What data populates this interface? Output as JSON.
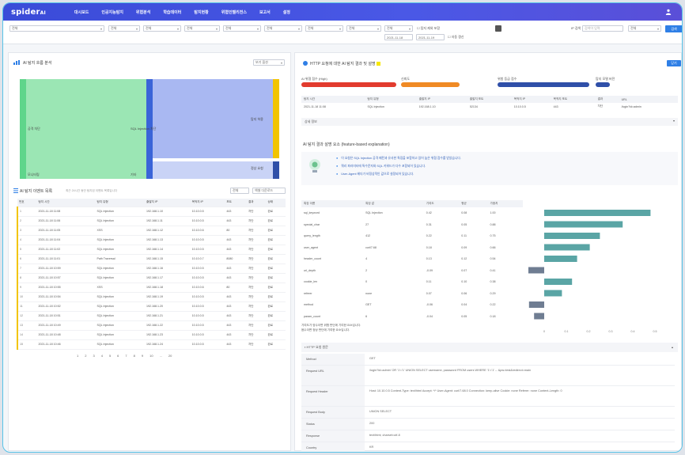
{
  "app": {
    "logo": "spider",
    "logo_suffix": "AI"
  },
  "nav": [
    "대시보드",
    "인공지능탐지",
    "위협분석",
    "학습데이터",
    "탐지현황",
    "위협인텔리전스",
    "보고서",
    "설정"
  ],
  "user_icon": "user-icon",
  "filters": {
    "type": "전체",
    "f2": "전체",
    "f3": "전체",
    "f4": "전체",
    "f5": "전체",
    "f6": "전체",
    "f7": "전체",
    "f8": "전체",
    "f9": "전체",
    "date1": "2021-11-18",
    "date2": "2021-11-19",
    "check1": "탐지 제외 포함",
    "check2": "자동 갱신",
    "search_placeholder": "검색어 입력",
    "search_label": "IP 검색",
    "search_button": "검색"
  },
  "left_panel": {
    "title": "AI 탐지 흐름 분석",
    "button": "보기 옵션",
    "sankey_labels": [
      "공격 차단",
      "SQL Injection 차단",
      "탐지 허용",
      "정상 요청",
      "모니터링",
      "기타"
    ],
    "list_title": "AI 탐지 이벤트 목록",
    "list_subtitle": "최근 24시간 동안 탐지된 이벤트 목록입니다",
    "list_btn1": "전체",
    "list_btn2": "엑셀 다운로드",
    "columns": [
      "번호",
      "탐지 시간",
      "탐지 유형",
      "출발지 IP",
      "목적지 IP",
      "포트",
      "결과",
      "상태"
    ],
    "rows": [
      [
        "1",
        "2021-11-18 11:08",
        "SQL Injection",
        "192.168.1.10",
        "10.10.0.5",
        "443",
        "차단",
        "완료"
      ],
      [
        "2",
        "2021-11-18 11:06",
        "SQL Injection",
        "192.168.1.11",
        "10.10.0.5",
        "443",
        "차단",
        "완료"
      ],
      [
        "3",
        "2021-11-18 11:05",
        "XSS",
        "192.168.1.12",
        "10.10.0.6",
        "80",
        "차단",
        "완료"
      ],
      [
        "4",
        "2021-11-18 11:04",
        "SQL Injection",
        "192.168.1.13",
        "10.10.0.5",
        "443",
        "차단",
        "완료"
      ],
      [
        "5",
        "2021-11-18 11:02",
        "SQL Injection",
        "192.168.1.14",
        "10.10.0.5",
        "443",
        "차단",
        "완료"
      ],
      [
        "6",
        "2021-11-18 11:01",
        "Path Traversal",
        "192.168.1.15",
        "10.10.0.7",
        "8080",
        "차단",
        "완료"
      ],
      [
        "7",
        "2021-11-18 10:59",
        "SQL Injection",
        "192.168.1.16",
        "10.10.0.5",
        "443",
        "차단",
        "완료"
      ],
      [
        "8",
        "2021-11-18 10:57",
        "SQL Injection",
        "192.168.1.17",
        "10.10.0.5",
        "443",
        "차단",
        "완료"
      ],
      [
        "9",
        "2021-11-18 10:55",
        "XSS",
        "192.168.1.18",
        "10.10.0.6",
        "80",
        "차단",
        "완료"
      ],
      [
        "10",
        "2021-11-18 10:54",
        "SQL Injection",
        "192.168.1.19",
        "10.10.0.5",
        "443",
        "차단",
        "완료"
      ],
      [
        "11",
        "2021-11-18 10:52",
        "SQL Injection",
        "192.168.1.20",
        "10.10.0.5",
        "443",
        "차단",
        "완료"
      ],
      [
        "12",
        "2021-11-18 10:51",
        "SQL Injection",
        "192.168.1.21",
        "10.10.0.5",
        "443",
        "차단",
        "완료"
      ],
      [
        "13",
        "2021-11-18 10:49",
        "SQL Injection",
        "192.168.1.22",
        "10.10.0.5",
        "443",
        "차단",
        "완료"
      ],
      [
        "14",
        "2021-11-18 10:48",
        "SQL Injection",
        "192.168.1.23",
        "10.10.0.5",
        "443",
        "차단",
        "완료"
      ],
      [
        "15",
        "2021-11-18 10:46",
        "SQL Injection",
        "192.168.1.24",
        "10.10.0.5",
        "443",
        "차단",
        "완료"
      ]
    ],
    "pages": [
      "1",
      "2",
      "3",
      "4",
      "5",
      "6",
      "7",
      "8",
      "9",
      "10",
      "...",
      "20"
    ]
  },
  "right_panel": {
    "title": "HTTP 요청에 대한 AI 탐지 결과 및 설명",
    "top_button": "닫기",
    "bar_labels": [
      "AI 위협 점수 (High)",
      "신뢰도",
      "위험 등급 점수",
      "탐지 모델 버전"
    ],
    "detail_columns": [
      "탐지 시간",
      "탐지 유형",
      "출발지 IP",
      "출발지 포트",
      "목적지 IP",
      "목적지 포트",
      "결과",
      "URL"
    ],
    "detail_row": [
      "2021-11-18 11:08",
      "SQL Injection",
      "192.168.1.10",
      "52134",
      "10.10.0.5",
      "443",
      "차단",
      "/login?id=admin"
    ],
    "more": "상세 정보",
    "explain_title": "AI 탐지 결과 설명 요소 (feature-based explanation)",
    "explain_items": [
      "이 요청은 SQL Injection 공격 패턴과 유사한 특징을 포함하고 있어 높은 위협 점수를 받았습니다.",
      "쿼리 파라미터에 특수문자와 SQL 키워드가 다수 포함되어 있습니다.",
      "User-Agent 헤더가 비정상적인 값으로 설정되어 있습니다."
    ],
    "feature_columns": [
      "특징 이름",
      "특징 값",
      "기여도",
      "평균",
      "가중치"
    ],
    "features": [
      [
        "sql_keyword",
        "SQL Injection",
        "0.42",
        "0.08",
        "1.00"
      ],
      [
        "special_char",
        "27",
        "0.31",
        "0.05",
        "0.88"
      ],
      [
        "query_length",
        "412",
        "0.22",
        "0.11",
        "0.75"
      ],
      [
        "user_agent",
        "curl/7.68",
        "0.18",
        "0.09",
        "0.66"
      ],
      [
        "header_count",
        "4",
        "0.13",
        "0.12",
        "0.54"
      ],
      [
        "url_depth",
        "2",
        "-0.09",
        "0.07",
        "0.41"
      ],
      [
        "cookie_len",
        "0",
        "0.11",
        "0.10",
        "0.38"
      ],
      [
        "referer",
        "none",
        "0.07",
        "0.06",
        "0.29"
      ],
      [
        "method",
        "GET",
        "-0.06",
        "0.04",
        "0.22"
      ],
      [
        "param_count",
        "6",
        "-0.04",
        "0.05",
        "0.18"
      ]
    ],
    "shap_values": [
      0.42,
      0.31,
      0.22,
      0.18,
      0.13,
      -0.09,
      0.11,
      0.07,
      -0.06,
      -0.04
    ],
    "shap_ticks": [
      "-0.1",
      "0",
      "0.1",
      "0.2",
      "0.3",
      "0.4",
      "0.5"
    ],
    "footnote1": "기여도가 양수이면 위협 판단에 기여한 요소입니다.",
    "footnote2": "음수이면 정상 판단에 기여한 요소입니다.",
    "http_title": "HTTP 요청 원문",
    "http_rows": [
      [
        "Method",
        "GET"
      ],
      [
        "Request URL",
        "/login?id=admin' OR '1'='1' UNION SELECT username, password FROM users WHERE '1'='1' -- &pw=test&redirect=main"
      ],
      [
        "Request Header",
        "Host: 10.10.0.5 Content-Type: text/html Accept: */* User-Agent: curl/7.68.0 Connection: keep-alive Cookie: none Referer: none Content-Length: 0"
      ],
      [
        "Request Body",
        "UNION SELECT"
      ],
      [
        "Status",
        "200"
      ],
      [
        "Response",
        "text/html; charset=utf-8"
      ],
      [
        "Country",
        "KR"
      ]
    ]
  },
  "colors": {
    "topbar": "#3a4bd8",
    "accent": "#2f7fe6",
    "sankey_green": "#9be6b4",
    "sankey_blue": "#a9b8f2",
    "sankey_yellow": "#f2c400",
    "bar_red": "#e23b2e",
    "bar_orange": "#f08a24",
    "bar_navy": "#2f4fa8",
    "shap_pos": "#5aa5a5",
    "shap_neg": "#6f7d92",
    "highlight": "#f6e700"
  }
}
